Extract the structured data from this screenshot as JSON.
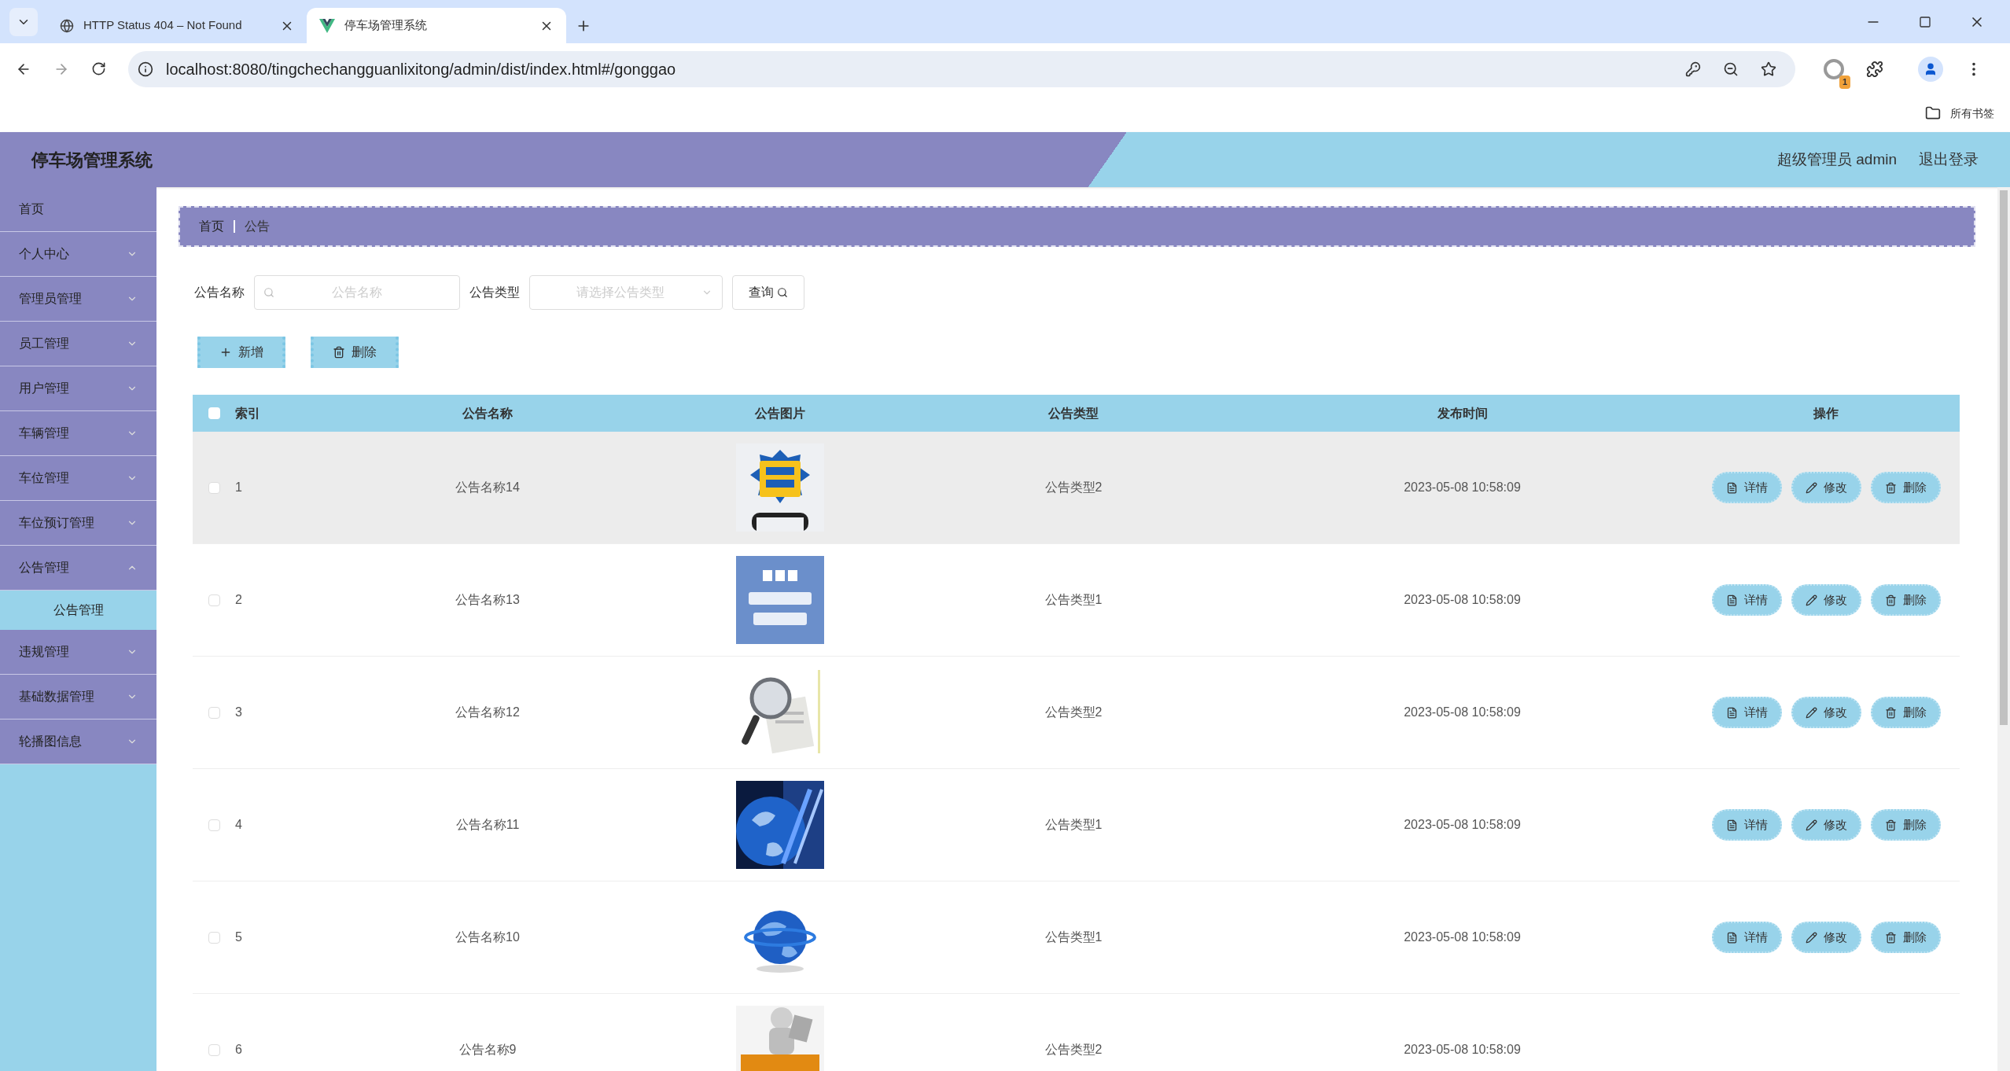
{
  "browser": {
    "tabs": [
      {
        "title": "HTTP Status 404 – Not Found",
        "kind": "globe",
        "selected": false
      },
      {
        "title": "停车场管理系统",
        "kind": "vue",
        "selected": true
      }
    ],
    "url": "localhost:8080/tingchechangguanlixitong/admin/dist/index.html#/gonggao",
    "extension_badge": "1",
    "bookmarks": "所有书签"
  },
  "header": {
    "title": "停车场管理系统",
    "user": "超级管理员 admin",
    "logout": "退出登录"
  },
  "sidebar": {
    "items": [
      {
        "label": "首页",
        "kind": "link"
      },
      {
        "label": "个人中心",
        "kind": "menu",
        "expanded": false
      },
      {
        "label": "管理员管理",
        "kind": "menu",
        "expanded": false
      },
      {
        "label": "员工管理",
        "kind": "menu",
        "expanded": false
      },
      {
        "label": "用户管理",
        "kind": "menu",
        "expanded": false
      },
      {
        "label": "车辆管理",
        "kind": "menu",
        "expanded": false
      },
      {
        "label": "车位管理",
        "kind": "menu",
        "expanded": false
      },
      {
        "label": "车位预订管理",
        "kind": "menu",
        "expanded": false
      },
      {
        "label": "公告管理",
        "kind": "menu",
        "expanded": true,
        "children": [
          {
            "label": "公告管理",
            "selected": true
          }
        ]
      },
      {
        "label": "违规管理",
        "kind": "menu",
        "expanded": false
      },
      {
        "label": "基础数据管理",
        "kind": "menu",
        "expanded": false
      },
      {
        "label": "轮播图信息",
        "kind": "menu",
        "expanded": false
      }
    ]
  },
  "breadcrumb": [
    "首页",
    "公告"
  ],
  "filters": [
    {
      "label": "公告名称",
      "kind": "text",
      "placeholder": "公告名称"
    },
    {
      "label": "公告类型",
      "kind": "select",
      "placeholder": "请选择公告类型"
    }
  ],
  "search_button": "查询",
  "toolbar": [
    {
      "label": "新增",
      "kind": "add"
    },
    {
      "label": "删除",
      "kind": "delete"
    }
  ],
  "table": {
    "all_checked": false,
    "columns": [
      "索引",
      "公告名称",
      "公告图片",
      "公告类型",
      "发布时间",
      "操作"
    ],
    "rows": [
      {
        "index": "1",
        "name": "公告名称14",
        "type": "公告类型2",
        "time": "2023-05-08 10:58:09",
        "checked": false,
        "highlighted": true,
        "actions": [
          {
            "label": "详情",
            "kind": "view"
          },
          {
            "label": "修改",
            "kind": "edit"
          },
          {
            "label": "删除",
            "kind": "delete"
          }
        ]
      },
      {
        "index": "2",
        "name": "公告名称13",
        "type": "公告类型1",
        "time": "2023-05-08 10:58:09",
        "checked": false,
        "highlighted": false,
        "actions": [
          {
            "label": "详情",
            "kind": "view"
          },
          {
            "label": "修改",
            "kind": "edit"
          },
          {
            "label": "删除",
            "kind": "delete"
          }
        ]
      },
      {
        "index": "3",
        "name": "公告名称12",
        "type": "公告类型2",
        "time": "2023-05-08 10:58:09",
        "checked": false,
        "highlighted": false,
        "actions": [
          {
            "label": "详情",
            "kind": "view"
          },
          {
            "label": "修改",
            "kind": "edit"
          },
          {
            "label": "删除",
            "kind": "delete"
          }
        ]
      },
      {
        "index": "4",
        "name": "公告名称11",
        "type": "公告类型1",
        "time": "2023-05-08 10:58:09",
        "checked": false,
        "highlighted": false,
        "actions": [
          {
            "label": "详情",
            "kind": "view"
          },
          {
            "label": "修改",
            "kind": "edit"
          },
          {
            "label": "删除",
            "kind": "delete"
          }
        ]
      },
      {
        "index": "5",
        "name": "公告名称10",
        "type": "公告类型1",
        "time": "2023-05-08 10:58:09",
        "checked": false,
        "highlighted": false,
        "actions": [
          {
            "label": "详情",
            "kind": "view"
          },
          {
            "label": "修改",
            "kind": "edit"
          },
          {
            "label": "删除",
            "kind": "delete"
          }
        ]
      },
      {
        "index": "6",
        "name": "公告名称9",
        "type": "公告类型2",
        "time": "2023-05-08 10:58:09",
        "checked": false,
        "highlighted": false
      }
    ]
  }
}
